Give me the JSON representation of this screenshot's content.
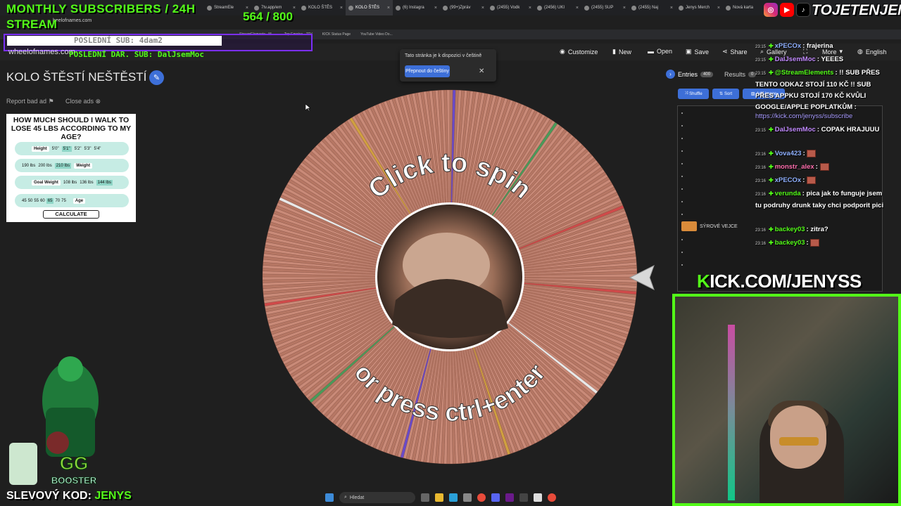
{
  "browser": {
    "tabs": [
      "StreamEle",
      "7tv.app/em",
      "KOLO ŠTĚS",
      "KOLO ŠTĚS",
      "(6) Instagra",
      "(99+)Zpráv",
      "(2455) Vodk",
      "(2456) UKI",
      "(2455) SUP",
      "(2455) Naj",
      "Jenys Merch",
      "Nová karta"
    ],
    "url_fragment": "heelofnames.com",
    "bookmarks": [
      "StreamElements - M...",
      "Top Emotes - 7TV",
      "KICK Status Page",
      "YouTube Video Do..."
    ]
  },
  "header": {
    "site_name": "wheelofnames.com",
    "customize": "Customize",
    "new": "New",
    "open": "Open",
    "save": "Save",
    "share": "Share",
    "gallery": "Gallery",
    "more": "More",
    "language": "English"
  },
  "page": {
    "title": "KOLO ŠTĚSTÍ NEŠTĚSTÍ",
    "report_ad": "Report bad ad",
    "close_ads": "Close ads"
  },
  "ad": {
    "title": "HOW MUCH SHOULD I WALK TO LOSE 45 LBS ACCORDING TO MY AGE?",
    "height_label": "Height",
    "heights": [
      "5'0\"",
      "5'1\"",
      "5'2\"",
      "5'3\"",
      "5'4\""
    ],
    "weight_label": "Weight",
    "weights": [
      "190 lbs",
      "200 lbs",
      "210 lbs"
    ],
    "goal_label": "Goal Weight",
    "goals": [
      "108 lbs",
      "136 lbs",
      "144 lbs"
    ],
    "age_label": "Age",
    "ages": [
      "45",
      "50",
      "55",
      "60",
      "65",
      "70",
      "75"
    ],
    "button": "CALCULATE"
  },
  "translate_popup": {
    "message": "Tato stránka je k dispozici v češtině",
    "button": "Přepnout do češtiny"
  },
  "wheel": {
    "top_text": "Click to spin",
    "bottom_text": "or press ctrl+enter",
    "slice_count": 400
  },
  "entries_panel": {
    "entries_tab": "Entries",
    "entries_count": "400",
    "results_tab": "Results",
    "results_count": "0",
    "shuffle": "Shuffle",
    "sort": "Sort",
    "add_image": "Add image",
    "visible_entry": "SÝROVÉ VEJCE"
  },
  "chat": [
    {
      "time": "23:15",
      "user": "xPECOx",
      "user_color": "#8fb0ff",
      "text": "frajerina"
    },
    {
      "time": "23:15",
      "user": "DalJsemMoc",
      "user_color": "#c28aff",
      "text": "YEEES"
    },
    {
      "time": "23:15",
      "user": "@StreamElements",
      "user_color": "#53fc18",
      "text": "!! SUB PŘES TENTO ODKAZ STOJÍ 110 KČ !! SUB PŘES APPKU STOJÍ 170 KČ KVŮLI GOOGLE/APPLE POPLATKŮM :"
    },
    {
      "link": "https://kick.com/jenyss/subscribe"
    },
    {
      "time": "23:15",
      "user": "DalJsemMoc",
      "user_color": "#c28aff",
      "text": "COPAK HRAJUUU"
    },
    {
      "time": "23:16",
      "user": "Vova423",
      "user_color": "#8fb0ff",
      "text": "",
      "emote": true
    },
    {
      "time": "23:16",
      "user": "monstr_alex",
      "user_color": "#ff6fae",
      "text": "",
      "emote": true
    },
    {
      "time": "23:16",
      "user": "xPECOx",
      "user_color": "#8fb0ff",
      "text": "",
      "emote": true
    },
    {
      "time": "23:16",
      "user": "verunda",
      "user_color": "#53fc18",
      "text": "pica jak to funguje jsem tu podruhy drunk taky chci podporit pici"
    },
    {
      "time": "23:16",
      "user": "backey03",
      "user_color": "#53fc18",
      "text": "zitra?"
    },
    {
      "time": "23:16",
      "user": "backey03",
      "user_color": "#53fc18",
      "text": "",
      "emote": true
    }
  ],
  "overlay": {
    "monthly": "MONTHLY SUBSCRIBERS / 24H",
    "stream": "STREAM",
    "sub_count": "564 / 800",
    "last_sub": "POSLEDNÍ SUB: 4dam2",
    "last_dar": "POSLEDNÍ DAR. SUB: DalJsemMoc",
    "handle": "TOJETENJENYS",
    "kick_url_k": "K",
    "kick_url_rest": "ICK.COM/JENYSS",
    "promo_label": "SLEVOVÝ KOD:",
    "promo_code": "JENYS",
    "mascot_brand": "GG BOOSTER"
  },
  "taskbar": {
    "search_placeholder": "Hledat"
  },
  "colors": {
    "accent_green": "#53fc18",
    "button_blue": "#3d6fd8",
    "wheel_slice": "#c98a78",
    "purple_border": "#7b2ff7"
  }
}
